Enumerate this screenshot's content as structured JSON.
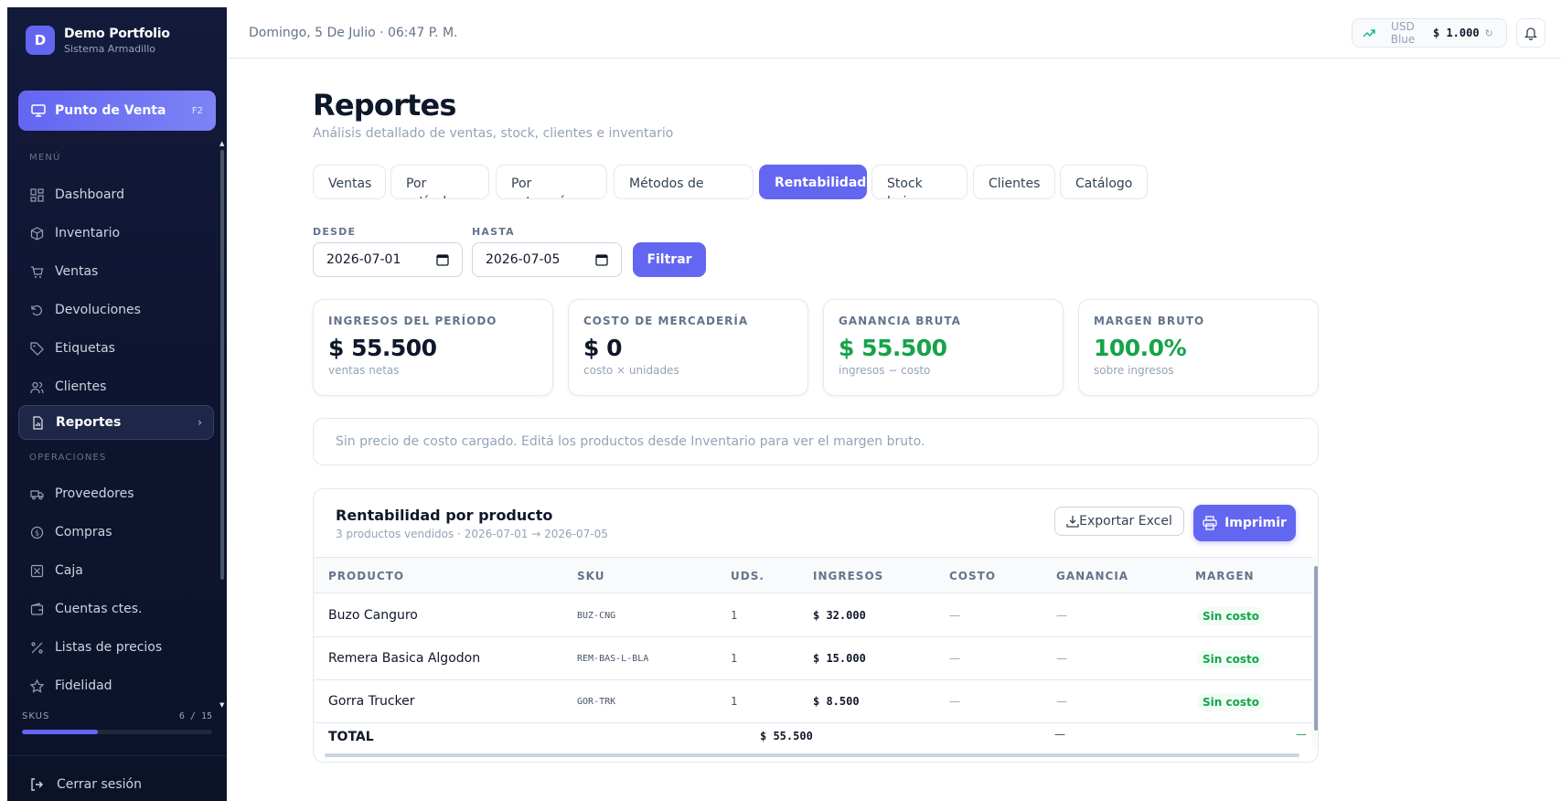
{
  "brand": {
    "initial": "D",
    "title": "Demo Portfolio",
    "subtitle": "Sistema Armadillo"
  },
  "pos": {
    "label": "Punto de Venta",
    "shortcut": "F2"
  },
  "sidebar": {
    "menu_label": "MENÚ",
    "menu_items": [
      {
        "label": "Dashboard",
        "icon": "dashboard-icon"
      },
      {
        "label": "Inventario",
        "icon": "box-icon"
      },
      {
        "label": "Ventas",
        "icon": "cart-icon"
      },
      {
        "label": "Devoluciones",
        "icon": "undo-icon"
      },
      {
        "label": "Etiquetas",
        "icon": "tag-icon"
      },
      {
        "label": "Clientes",
        "icon": "users-icon"
      },
      {
        "label": "Reportes",
        "icon": "report-icon",
        "active": true
      }
    ],
    "ops_label": "OPERACIONES",
    "ops_items": [
      {
        "label": "Proveedores",
        "icon": "truck-icon"
      },
      {
        "label": "Compras",
        "icon": "coin-icon"
      },
      {
        "label": "Caja",
        "icon": "cash-register-icon"
      },
      {
        "label": "Cuentas ctes.",
        "icon": "wallet-icon"
      },
      {
        "label": "Listas de precios",
        "icon": "percent-icon"
      },
      {
        "label": "Fidelidad",
        "icon": "star-icon"
      }
    ],
    "skus": {
      "label": "SKUS",
      "value": "6 / 15",
      "fraction": 0.4
    },
    "logout": "Cerrar sesión"
  },
  "header": {
    "date": "Domingo, 5 De Julio · 06:47 P. M.",
    "currency": "USD Blue",
    "rate": "$ 1.000"
  },
  "page": {
    "title": "Reportes",
    "subtitle": "Análisis detallado de ventas, stock, clientes e inventario"
  },
  "tabs": [
    "Ventas",
    "Por artículo",
    "Por categoría",
    "Métodos de pago",
    "Rentabilidad",
    "Stock bajo",
    "Clientes",
    "Catálogo"
  ],
  "filters": {
    "from_label": "DESDE",
    "from_value": "2026-07-01",
    "to_label": "HASTA",
    "to_value": "2026-07-05",
    "button": "Filtrar"
  },
  "kpis": [
    {
      "label": "INGRESOS DEL PERÍODO",
      "value": "$ 55.500",
      "note": "ventas netas",
      "color": "#0f172a"
    },
    {
      "label": "COSTO DE MERCADERÍA",
      "value": "$ 0",
      "note": "costo × unidades",
      "color": "#0f172a"
    },
    {
      "label": "GANANCIA BRUTA",
      "value": "$ 55.500",
      "note": "ingresos − costo",
      "color": "#16a34a"
    },
    {
      "label": "MARGEN BRUTO",
      "value": "100.0%",
      "note": "sobre ingresos",
      "color": "#16a34a"
    }
  ],
  "notice": "Sin precio de costo cargado. Editá los productos desde Inventario para ver el margen bruto.",
  "table": {
    "title": "Rentabilidad por producto",
    "subtitle": "3 productos vendidos · 2026-07-01 → 2026-07-05",
    "export_label": "Exportar Excel",
    "print_label": "Imprimir",
    "columns": [
      "PRODUCTO",
      "SKU",
      "UDS.",
      "INGRESOS",
      "COSTO",
      "GANANCIA",
      "MARGEN"
    ],
    "rows": [
      {
        "producto": "Buzo Canguro",
        "sku": "BUZ-CNG",
        "uds": "1",
        "ingresos": "$ 32.000",
        "costo": "—",
        "ganancia": "—",
        "margen": "Sin costo"
      },
      {
        "producto": "Remera Basica Algodon",
        "sku": "REM-BAS-L-BLA",
        "uds": "1",
        "ingresos": "$ 15.000",
        "costo": "—",
        "ganancia": "—",
        "margen": "Sin costo"
      },
      {
        "producto": "Gorra Trucker",
        "sku": "GOR-TRK",
        "uds": "1",
        "ingresos": "$ 8.500",
        "costo": "—",
        "ganancia": "—",
        "margen": "Sin costo"
      }
    ],
    "total": {
      "label": "TOTAL",
      "ingresos": "$ 55.500",
      "ganancia": "—",
      "margen": "—"
    }
  },
  "colors": {
    "accent": "#6366f1",
    "success": "#16a34a",
    "sidebar_bg": "#0f1530"
  }
}
